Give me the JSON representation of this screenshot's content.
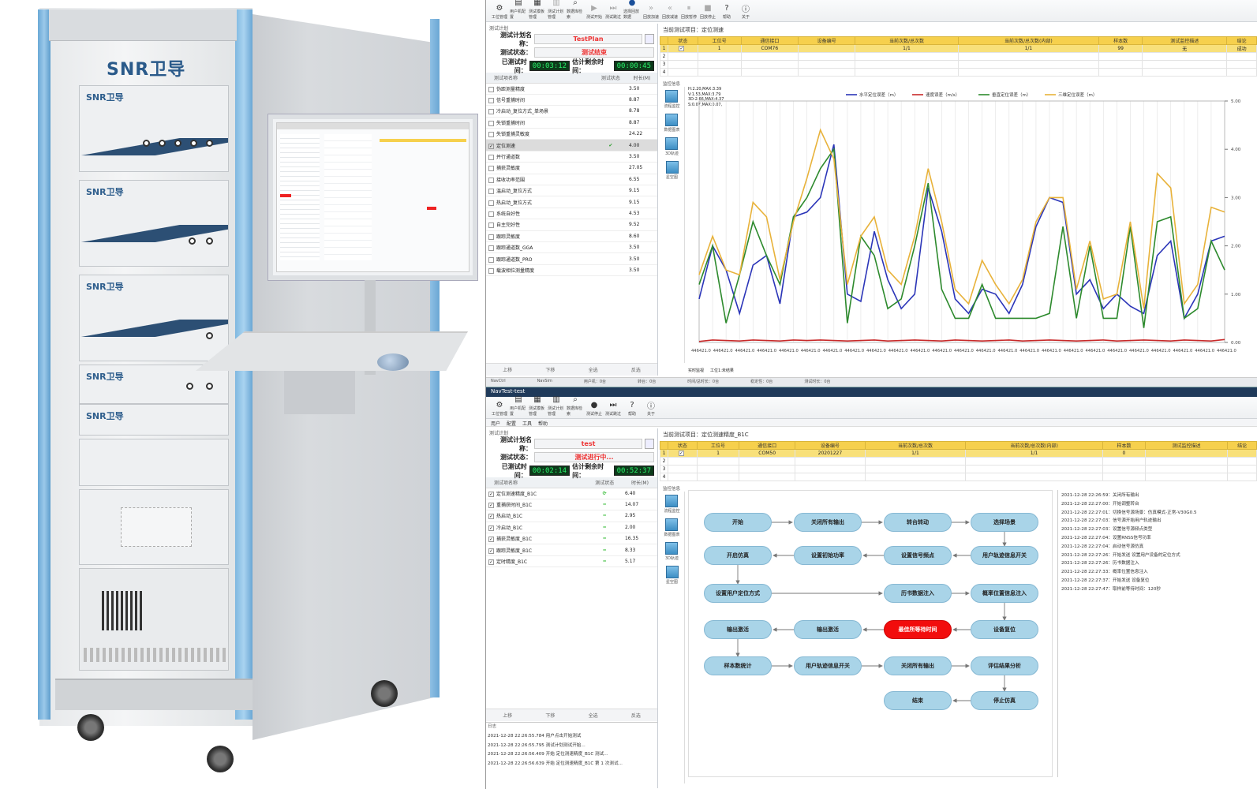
{
  "cabinet": {
    "brand": "SNR卫导",
    "brand_small": "SNR卫导",
    "units": [
      "SNR卫导",
      "SNR卫导",
      "SNR卫导",
      "SNR卫导",
      "SNR卫导"
    ]
  },
  "toolbar1": [
    {
      "label": "工位管理",
      "icon": "gear-icon",
      "enabled": true
    },
    {
      "label": "用户机配置",
      "icon": "user-device-icon",
      "enabled": true
    },
    {
      "label": "测试模板管理",
      "icon": "template-icon",
      "enabled": true
    },
    {
      "label": "测试计划管理",
      "icon": "plan-icon",
      "enabled": false
    },
    {
      "label": "数据库检索",
      "icon": "database-search-icon",
      "enabled": true
    },
    {
      "label": "测试开始",
      "icon": "play-icon",
      "enabled": false
    },
    {
      "label": "测试跳过",
      "icon": "skip-icon",
      "enabled": false
    },
    {
      "label": "选择回放数据",
      "icon": "stop-icon",
      "enabled": true
    },
    {
      "label": "回放加速",
      "icon": "fast-forward-icon",
      "enabled": false
    },
    {
      "label": "回放减速",
      "icon": "rewind-icon",
      "enabled": false
    },
    {
      "label": "回放暂停",
      "icon": "pause-icon",
      "enabled": false
    },
    {
      "label": "回放停止",
      "icon": "stop-square-icon",
      "enabled": false
    },
    {
      "label": "帮助",
      "icon": "help-icon",
      "enabled": true
    },
    {
      "label": "关于",
      "icon": "info-icon",
      "enabled": true
    }
  ],
  "win1": {
    "panel_caption": "测试计划",
    "plan_label": "测试计划名称：",
    "plan_value": "TestPlan",
    "state_label": "测试状态：",
    "state_value": "测试结束",
    "elapsed_label": "已测试时间：",
    "elapsed_value": "00:03:12",
    "remain_label": "估计剩余时间：",
    "remain_value": "00:00:45",
    "list_headers": [
      "测试项名称",
      "测试状态",
      "时长(M)"
    ],
    "tests": [
      {
        "name": "伪距测量精度",
        "status": "",
        "dur": "3.50",
        "checked": false
      },
      {
        "name": "信号重捕时间",
        "status": "",
        "dur": "8.87",
        "checked": false
      },
      {
        "name": "冷启动_复位方式_单场景",
        "status": "",
        "dur": "8.78",
        "checked": false
      },
      {
        "name": "失锁重捕时间",
        "status": "",
        "dur": "8.87",
        "checked": false
      },
      {
        "name": "失锁重捕灵敏度",
        "status": "",
        "dur": "24.22",
        "checked": false
      },
      {
        "name": "定位测速",
        "status": "✔",
        "dur": "4.00",
        "checked": true,
        "selected": true
      },
      {
        "name": "并行通道数",
        "status": "",
        "dur": "3.50",
        "checked": false
      },
      {
        "name": "捕获灵敏度",
        "status": "",
        "dur": "27.05",
        "checked": false
      },
      {
        "name": "接收功率范围",
        "status": "",
        "dur": "6.55",
        "checked": false
      },
      {
        "name": "温启动_复位方式",
        "status": "",
        "dur": "9.15",
        "checked": false
      },
      {
        "name": "热启动_复位方式",
        "status": "",
        "dur": "9.15",
        "checked": false
      },
      {
        "name": "系统自好性",
        "status": "",
        "dur": "4.53",
        "checked": false
      },
      {
        "name": "自主完好性",
        "status": "",
        "dur": "9.52",
        "checked": false
      },
      {
        "name": "跟踪灵敏度",
        "status": "",
        "dur": "8.60",
        "checked": false
      },
      {
        "name": "跟踪通道数_GGA",
        "status": "",
        "dur": "3.50",
        "checked": false
      },
      {
        "name": "跟踪通道数_PRO",
        "status": "",
        "dur": "3.50",
        "checked": false
      },
      {
        "name": "载波相位测量精度",
        "status": "",
        "dur": "3.50",
        "checked": false
      }
    ],
    "bottom_buttons": [
      "上移",
      "下移",
      "全选",
      "反选"
    ],
    "project_title": "当前测试项目：定位测速",
    "grid_headers": [
      "状态",
      "工位号",
      "通信接口",
      "设备编号",
      "当前次数/总次数",
      "当前次数/总次数(内部)",
      "样本数",
      "测试监控描述",
      "结论"
    ],
    "grid_rows": [
      {
        "idx": "1",
        "checked": true,
        "station": "1",
        "port": "COM76",
        "dev": "",
        "cur": "1/1",
        "cur2": "1/1",
        "samples": "99",
        "desc": "无",
        "result": "成功"
      },
      {
        "idx": "2"
      },
      {
        "idx": "3"
      },
      {
        "idx": "4"
      }
    ],
    "monitor_caption": "监控信息",
    "side_icons": [
      "流程监控",
      "数据图表",
      "3D轨迹",
      "星空图"
    ],
    "stats_text": [
      "H:2.20,MAX:3.39",
      "V:1.53,MAX:3.79",
      "3D:2.66,MAX:4.37",
      "S:0.07,MAX:0.07,"
    ],
    "chart_tabs": [
      "实时监视",
      "工位1:未结果"
    ],
    "task_tabs": [
      "NavCtrl",
      "NavSim"
    ],
    "status": [
      "用户机：0台",
      "转台：0台",
      "时间/总时长：0台",
      "稳定性：0台",
      "测试时长：0台"
    ]
  },
  "chart_data": {
    "type": "line",
    "series": [
      {
        "name": "水平定位误差（m）",
        "color": "#2b35b8",
        "values": [
          0.9,
          2.0,
          1.5,
          0.6,
          1.6,
          1.8,
          0.8,
          2.6,
          2.7,
          3.0,
          4.1,
          1.0,
          0.85,
          2.3,
          1.3,
          0.7,
          1.0,
          3.2,
          2.3,
          0.9,
          0.6,
          1.1,
          1.0,
          0.6,
          1.2,
          2.4,
          3.0,
          2.9,
          1.0,
          1.3,
          0.7,
          1.0,
          0.75,
          0.6,
          1.8,
          2.1,
          0.5,
          1.0,
          2.1,
          2.2
        ]
      },
      {
        "name": "速度误差（m/s）",
        "color": "#c82a2a",
        "values": [
          0.02,
          0.05,
          0.04,
          0.03,
          0.05,
          0.04,
          0.03,
          0.05,
          0.04,
          0.05,
          0.04,
          0.03,
          0.04,
          0.05,
          0.03,
          0.04,
          0.05,
          0.04,
          0.03,
          0.05,
          0.04,
          0.03,
          0.04,
          0.05,
          0.03,
          0.04,
          0.05,
          0.04,
          0.03,
          0.04,
          0.05,
          0.03,
          0.04,
          0.05,
          0.04,
          0.03,
          0.05,
          0.04,
          0.03,
          0.06
        ]
      },
      {
        "name": "垂直定位误差（m）",
        "color": "#2d8a2d",
        "values": [
          1.2,
          2.0,
          0.4,
          1.4,
          2.5,
          1.8,
          1.2,
          2.6,
          3.0,
          3.6,
          4.0,
          0.4,
          2.2,
          1.8,
          0.7,
          0.9,
          2.0,
          3.3,
          1.1,
          0.5,
          0.5,
          1.2,
          0.5,
          0.5,
          0.5,
          0.5,
          0.6,
          2.4,
          0.5,
          2.0,
          0.5,
          0.5,
          2.4,
          0.3,
          2.5,
          2.6,
          0.5,
          0.7,
          2.1,
          1.5
        ]
      },
      {
        "name": "三维定位误差（m）",
        "color": "#e8b23a",
        "values": [
          1.4,
          2.2,
          1.5,
          1.4,
          2.9,
          2.6,
          1.3,
          2.5,
          3.4,
          4.4,
          3.8,
          1.2,
          2.2,
          2.6,
          1.5,
          1.2,
          2.2,
          3.6,
          2.5,
          1.1,
          0.8,
          1.7,
          1.2,
          0.8,
          1.3,
          2.5,
          3.0,
          3.0,
          1.1,
          2.1,
          0.9,
          1.0,
          2.5,
          0.7,
          3.5,
          3.2,
          0.8,
          1.2,
          2.8,
          2.7
        ]
      }
    ],
    "x_tick_labels": [
      "446421.0",
      "446421.0",
      "446421.0",
      "446421.0",
      "446421.0",
      "446421.0",
      "446421.0",
      "446421.0",
      "446421.0",
      "446421.0",
      "446421.0",
      "446421.0",
      "446421.0",
      "446421.0",
      "446421.0",
      "446421.0",
      "446421.0",
      "446421.0",
      "446421.0",
      "446421.0",
      "446421.0",
      "446421.0",
      "446421.0",
      "446421.0",
      "446421.0"
    ],
    "y_tick_labels": [
      "0.00",
      "1.00",
      "2.00",
      "3.00",
      "4.00",
      "5.00"
    ],
    "ylim": [
      0,
      5
    ],
    "grid": true,
    "legend": "top"
  },
  "toolbar2": [
    {
      "label": "工位管理",
      "icon": "gear-icon"
    },
    {
      "label": "用户机配置",
      "icon": "user-device-icon"
    },
    {
      "label": "测试模板管理",
      "icon": "template-icon"
    },
    {
      "label": "测试计划管理",
      "icon": "plan-icon"
    },
    {
      "label": "数据库检索",
      "icon": "database-search-icon"
    },
    {
      "label": "测试停止",
      "icon": "stop-icon"
    },
    {
      "label": "测试跳过",
      "icon": "skip-icon"
    },
    {
      "label": "帮助",
      "icon": "help-icon"
    },
    {
      "label": "关于",
      "icon": "info-icon"
    }
  ],
  "win2": {
    "window_title": "NavTest-test",
    "menu": [
      "用户",
      "配置",
      "工具",
      "帮助"
    ],
    "panel_caption": "测试计划",
    "plan_label": "测试计划名称：",
    "plan_value": "test",
    "state_label": "测试状态：",
    "state_value": "测试进行中...",
    "elapsed_label": "已测试时间：",
    "elapsed_value": "00:02:14",
    "remain_label": "估计剩余时间：",
    "remain_value": "00:52:37",
    "list_headers": [
      "测试项名称",
      "测试状态",
      "时长(M)"
    ],
    "tests": [
      {
        "name": "定位测速精度_B1C",
        "status": "⟳",
        "dur": "6.40"
      },
      {
        "name": "重捕获时间_B1C",
        "status": "━",
        "dur": "14.07"
      },
      {
        "name": "热启动_B1C",
        "status": "━",
        "dur": "2.95"
      },
      {
        "name": "冷启动_B1C",
        "status": "━",
        "dur": "2.00"
      },
      {
        "name": "捕获灵敏度_B1C",
        "status": "━",
        "dur": "16.35"
      },
      {
        "name": "跟踪灵敏度_B1C",
        "status": "━",
        "dur": "8.33"
      },
      {
        "name": "定时精度_B1C",
        "status": "━",
        "dur": "5.17"
      }
    ],
    "bottom_buttons": [
      "上移",
      "下移",
      "全选",
      "反选"
    ],
    "log_caption": "日志",
    "bottom_log": [
      "2021-12-28 22:26:55.784 用户点击开始测试",
      "2021-12-28 22:26:55.795 测试计划测试开始...",
      "2021-12-28 22:26:56.409 开始 定位测速精度_B1C 测试...",
      "2021-12-28 22:26:56.639 开始 定位测速精度_B1C 第 1 次测试..."
    ],
    "project_title": "当前测试项目：定位测速精度_B1C",
    "grid_headers": [
      "状态",
      "工位号",
      "通信接口",
      "设备编号",
      "当前次数/总次数",
      "当前次数/总次数(内部)",
      "样本数",
      "测试监控描述",
      "结论"
    ],
    "grid_rows": [
      {
        "idx": "1",
        "checked": true,
        "station": "1",
        "port": "COM50",
        "dev": "20201227",
        "cur": "1/1",
        "cur2": "1/1",
        "samples": "0",
        "desc": "",
        "result": ""
      },
      {
        "idx": "2"
      },
      {
        "idx": "3"
      },
      {
        "idx": "4"
      }
    ],
    "monitor_caption": "监控信息",
    "side_icons": [
      "流程监控",
      "数据图表",
      "3D轨迹",
      "星空图"
    ],
    "flow": [
      "开始",
      "关闭所有输出",
      "转台转动",
      "选择场景",
      "开启仿真",
      "设置初始功率",
      "设置信号频点",
      "用户轨迹信息开关",
      "设置用户定位方式",
      "历书数据注入",
      "概率位置信息注入",
      "输出激活",
      "输出激活",
      "最佳所等待时间",
      "设备复位",
      "样本数统计",
      "用户轨迹信息开关",
      "关闭所有输出",
      "评估结果分析",
      "结束",
      "停止仿真"
    ],
    "log": [
      "2021-12-28 22:26:59：关闭所有输出",
      "2021-12-28 22:27:00：开始调整转台",
      "2021-12-28 22:27:01：切换信号源场景：仿真模式-正常-V30G0.5",
      "2021-12-28 22:27:03：信号源开始用户轨迹输出",
      "2021-12-28 22:27:03：设置信号源频点类型",
      "2021-12-28 22:27:04：设置RNSS信号功率",
      "2021-12-28 22:27:04：启动信号源仿真",
      "2021-12-28 22:27:26：开始发送 设置用户设备的定位方式",
      "2021-12-28 22:27:26：历书数据注入",
      "2021-12-28 22:27:33：概率位置信息注入",
      "2021-12-28 22:27:37：开始发送 设备复位",
      "2021-12-28 22:27:47：取样前等待时间：120秒"
    ]
  }
}
